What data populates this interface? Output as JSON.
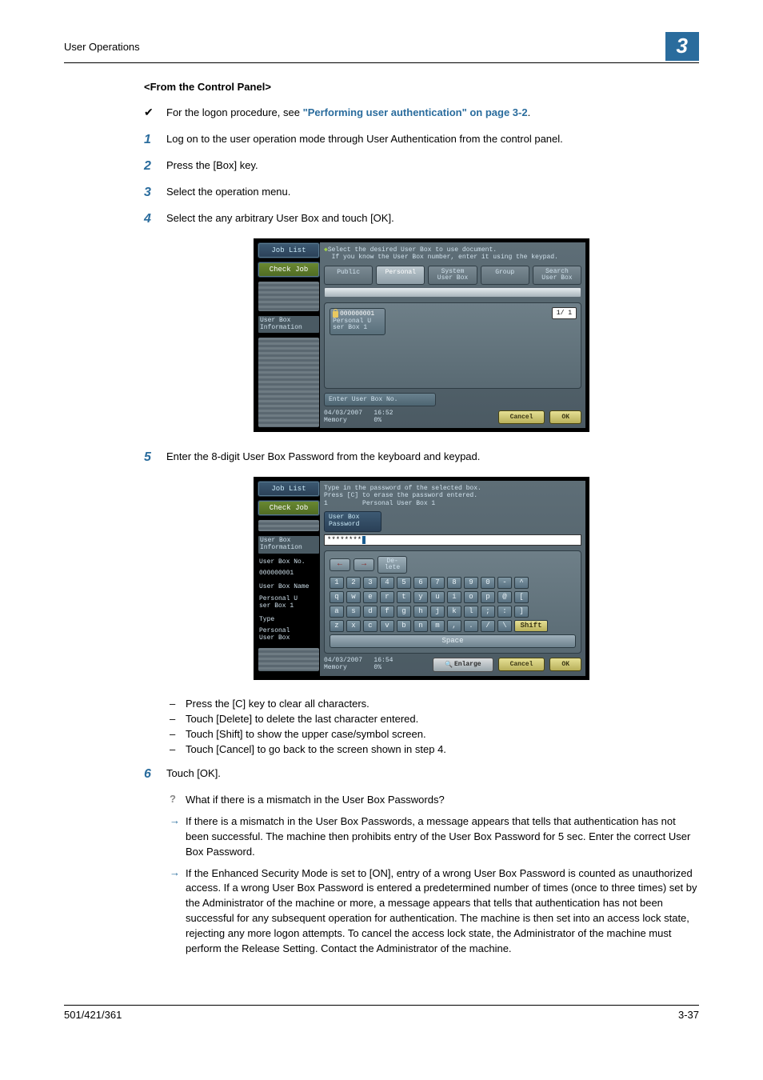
{
  "header": {
    "title": "User Operations",
    "chapter": "3"
  },
  "section_title": "<From the Control Panel>",
  "note": {
    "prefix": "For the logon procedure, see ",
    "link": "\"Performing user authentication\" on page 3-2",
    "suffix": "."
  },
  "steps": {
    "s1": "Log on to the user operation mode through User Authentication from the control panel.",
    "s2": "Press the [Box] key.",
    "s3": "Select the operation menu.",
    "s4": "Select the any arbitrary User Box and touch [OK].",
    "s5": "Enter the 8-digit User Box Password from the keyboard and keypad.",
    "s6": "Touch [OK]."
  },
  "sub": {
    "d1": "Press the [C] key to clear all characters.",
    "d2": "Touch [Delete] to delete the last character entered.",
    "d3": "Touch [Shift] to show the upper case/symbol screen.",
    "d4": "Touch [Cancel] to go back to the screen shown in step 4."
  },
  "qa": {
    "q": "What if there is a mismatch in the User Box Passwords?",
    "a1": "If there is a mismatch in the User Box Passwords, a message appears that tells that authentication has not been successful. The machine then prohibits entry of the User Box Password for 5 sec. Enter the correct User Box Password.",
    "a2": "If the Enhanced Security Mode is set to [ON], entry of a wrong User Box Password is counted as unauthorized access. If a wrong User Box Password is entered a predetermined number of times (once to three times) set by the Administrator of the machine or more, a message appears that tells that authentication has not been successful for any subsequent operation for authentication. The machine is then set into an access lock state, rejecting any more logon attempts. To cancel the access lock state, the Administrator of the machine must perform the Release Setting. Contact the Administrator of the machine."
  },
  "shot1": {
    "left": {
      "job_list": "Job List",
      "check_job": "Check Job",
      "box_info": "User Box\nInformation"
    },
    "msg1": "Select the desired User Box to use document.",
    "msg2": "If you know the User Box number, enter it using the keypad.",
    "tabs": {
      "public": "Public",
      "personal": "Personal",
      "system": "System\nUser Box",
      "group": "Group",
      "search": "Search\nUser Box"
    },
    "tile": {
      "num": "000000001",
      "name": "Personal U\nser Box 1"
    },
    "page": "1/ 1",
    "enter": "Enter User Box No.",
    "footer": {
      "date": "04/03/2007",
      "time": "16:52",
      "mem": "Memory",
      "mem_val": "0%",
      "cancel": "Cancel",
      "ok": "OK"
    }
  },
  "shot2": {
    "left": {
      "job_list": "Job List",
      "check_job": "Check Job",
      "box_info": "User Box\nInformation",
      "no_lbl": "User Box No.",
      "no_val": "000000001",
      "name_lbl": "User Box Name",
      "name_val": "Personal U\nser Box 1",
      "type_lbl": "Type",
      "type_val": "Personal\nUser Box"
    },
    "msg1": "Type in the password of the selected box.",
    "msg2": "Press [C] to erase the password entered.",
    "msg3": "Personal User Box 1",
    "pass_label": "User Box\nPassword",
    "pass_value": "********",
    "delete": "De-\nlete",
    "rows": {
      "r1": [
        "1",
        "2",
        "3",
        "4",
        "5",
        "6",
        "7",
        "8",
        "9",
        "0",
        "-",
        "^"
      ],
      "r2": [
        "q",
        "w",
        "e",
        "r",
        "t",
        "y",
        "u",
        "i",
        "o",
        "p",
        "@",
        "["
      ],
      "r3": [
        "a",
        "s",
        "d",
        "f",
        "g",
        "h",
        "j",
        "k",
        "l",
        ";",
        ":",
        "]"
      ],
      "r4": [
        "z",
        "x",
        "c",
        "v",
        "b",
        "n",
        "m",
        ",",
        ".",
        "/",
        "\\"
      ]
    },
    "shift": "Shift",
    "space": "Space",
    "footer": {
      "date": "04/03/2007",
      "time": "16:54",
      "mem": "Memory",
      "mem_val": "0%",
      "enlarge": "Enlarge",
      "cancel": "Cancel",
      "ok": "OK"
    }
  },
  "footer": {
    "left": "501/421/361",
    "right": "3-37"
  }
}
